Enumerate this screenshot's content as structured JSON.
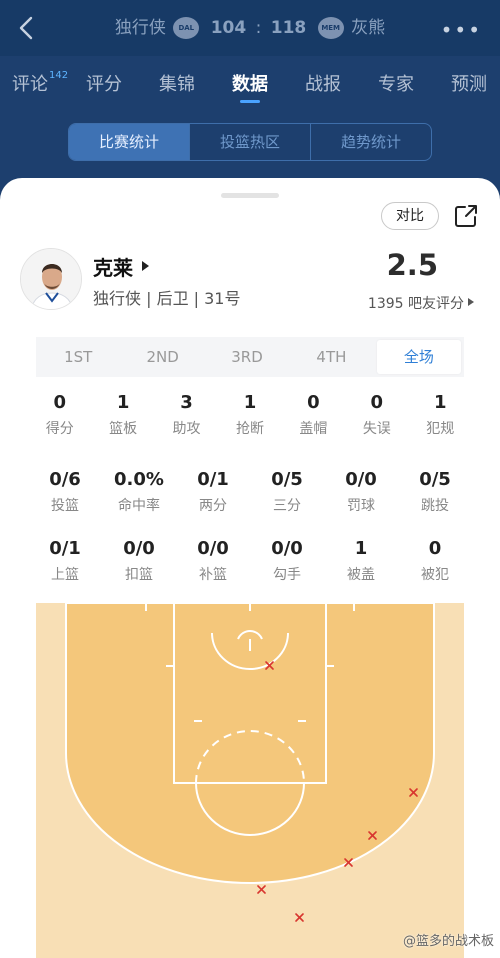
{
  "header": {
    "home_team": "独行侠",
    "home_logo": "DAL",
    "home_score": "104",
    "separator": ":",
    "away_score": "118",
    "away_logo": "MEM",
    "away_team": "灰熊"
  },
  "tabs": [
    {
      "label": "评论",
      "badge": "142"
    },
    {
      "label": "评分"
    },
    {
      "label": "集锦"
    },
    {
      "label": "数据"
    },
    {
      "label": "战报"
    },
    {
      "label": "专家"
    },
    {
      "label": "预测"
    }
  ],
  "segments": [
    "比赛统计",
    "投篮热区",
    "趋势统计"
  ],
  "compare_label": "对比",
  "player": {
    "name": "克莱",
    "info": "独行侠 | 后卫 | 31号",
    "rating": "2.5",
    "rating_count": "1395 吧友评分"
  },
  "quarters": [
    "1ST",
    "2ND",
    "3RD",
    "4TH",
    "全场"
  ],
  "stats_row1": [
    {
      "value": "0",
      "label": "得分"
    },
    {
      "value": "1",
      "label": "篮板"
    },
    {
      "value": "3",
      "label": "助攻"
    },
    {
      "value": "1",
      "label": "抢断"
    },
    {
      "value": "0",
      "label": "盖帽"
    },
    {
      "value": "0",
      "label": "失误"
    },
    {
      "value": "1",
      "label": "犯规"
    }
  ],
  "stats_row2": [
    {
      "value": "0/6",
      "label": "投篮"
    },
    {
      "value": "0.0%",
      "label": "命中率"
    },
    {
      "value": "0/1",
      "label": "两分"
    },
    {
      "value": "0/5",
      "label": "三分"
    },
    {
      "value": "0/0",
      "label": "罚球"
    },
    {
      "value": "0/5",
      "label": "跳投"
    }
  ],
  "stats_row3": [
    {
      "value": "0/1",
      "label": "上篮"
    },
    {
      "value": "0/0",
      "label": "扣篮"
    },
    {
      "value": "0/0",
      "label": "补篮"
    },
    {
      "value": "0/0",
      "label": "勾手"
    },
    {
      "value": "1",
      "label": "被盖"
    },
    {
      "value": "0",
      "label": "被犯"
    }
  ],
  "watermark": "@篮多的战术板",
  "colors": {
    "header_bg": "#173a66",
    "accent": "#2f7fd6",
    "court_paint": "#f4c77b",
    "court_outer": "#f8dfb5",
    "miss_marker": "#d8362f"
  }
}
